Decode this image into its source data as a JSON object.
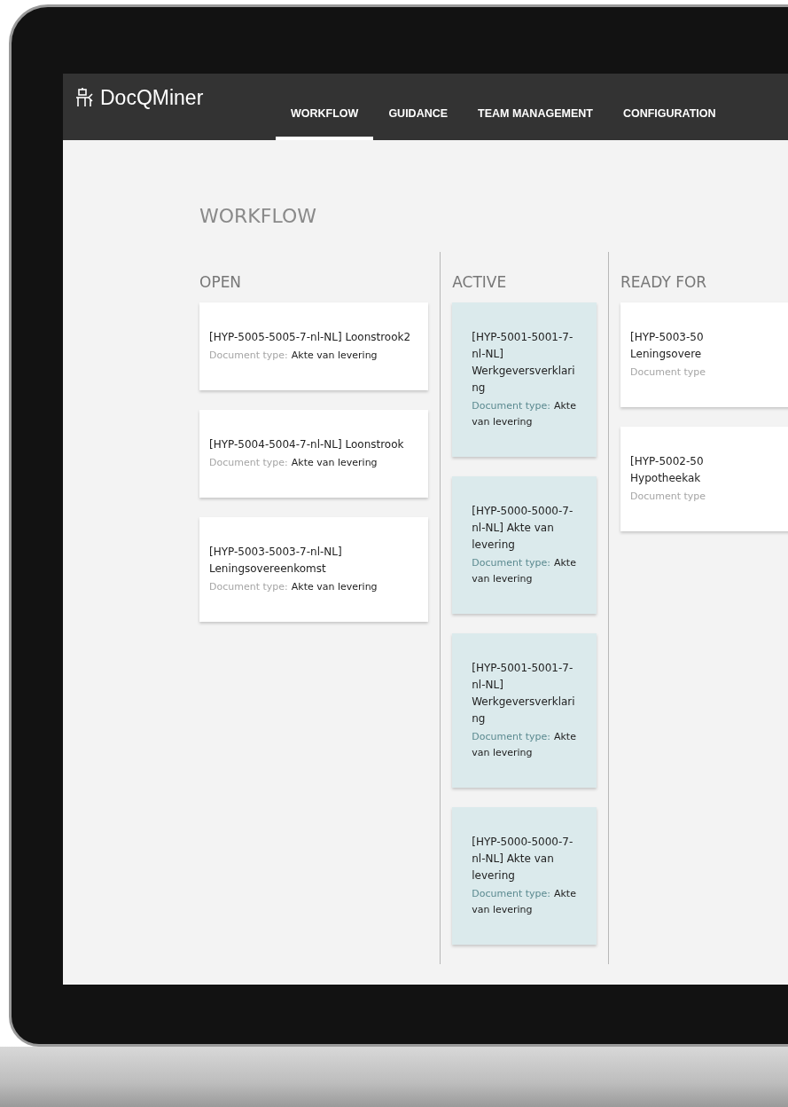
{
  "app": {
    "name": "DocQMiner"
  },
  "tabs": [
    {
      "label": "WORKFLOW",
      "selected": true
    },
    {
      "label": "GUIDANCE",
      "selected": false
    },
    {
      "label": "TEAM MANAGEMENT",
      "selected": false
    },
    {
      "label": "CONFIGURATION",
      "selected": false
    }
  ],
  "page_title": "WORKFLOW",
  "columns": [
    {
      "title": "OPEN",
      "highlighted": false,
      "cards": [
        {
          "title": "[HYP-5005-5005-7-nl-NL] Loonstrook2",
          "type_label": "Document type:",
          "type_value": "Akte van levering"
        },
        {
          "title": "[HYP-5004-5004-7-nl-NL] Loonstrook",
          "type_label": "Document type:",
          "type_value": "Akte van levering"
        },
        {
          "title": "[HYP-5003-5003-7-nl-NL] Leningsovereenkomst",
          "type_label": "Document type:",
          "type_value": "Akte van levering"
        }
      ]
    },
    {
      "title": "ACTIVE",
      "highlighted": true,
      "cards": [
        {
          "title": "[HYP-5001-5001-7-nl-NL] Werkgeversverklaring",
          "type_label": "Document type:",
          "type_value": "Akte van levering"
        },
        {
          "title": "[HYP-5000-5000-7-nl-NL] Akte van levering",
          "type_label": "Document type:",
          "type_value": "Akte van levering"
        },
        {
          "title": "[HYP-5001-5001-7-nl-NL] Werkgeversverklaring",
          "type_label": "Document type:",
          "type_value": "Akte van levering"
        },
        {
          "title": "[HYP-5000-5000-7-nl-NL] Akte van levering",
          "type_label": "Document type:",
          "type_value": "Akte van levering"
        }
      ]
    },
    {
      "title": "READY FOR",
      "highlighted": false,
      "cards": [
        {
          "title": "[HYP-5003-50\nLeningsovere",
          "type_label": "Document type"
        },
        {
          "title": "[HYP-5002-50\nHypotheekak",
          "type_label": "Document type"
        }
      ]
    }
  ]
}
